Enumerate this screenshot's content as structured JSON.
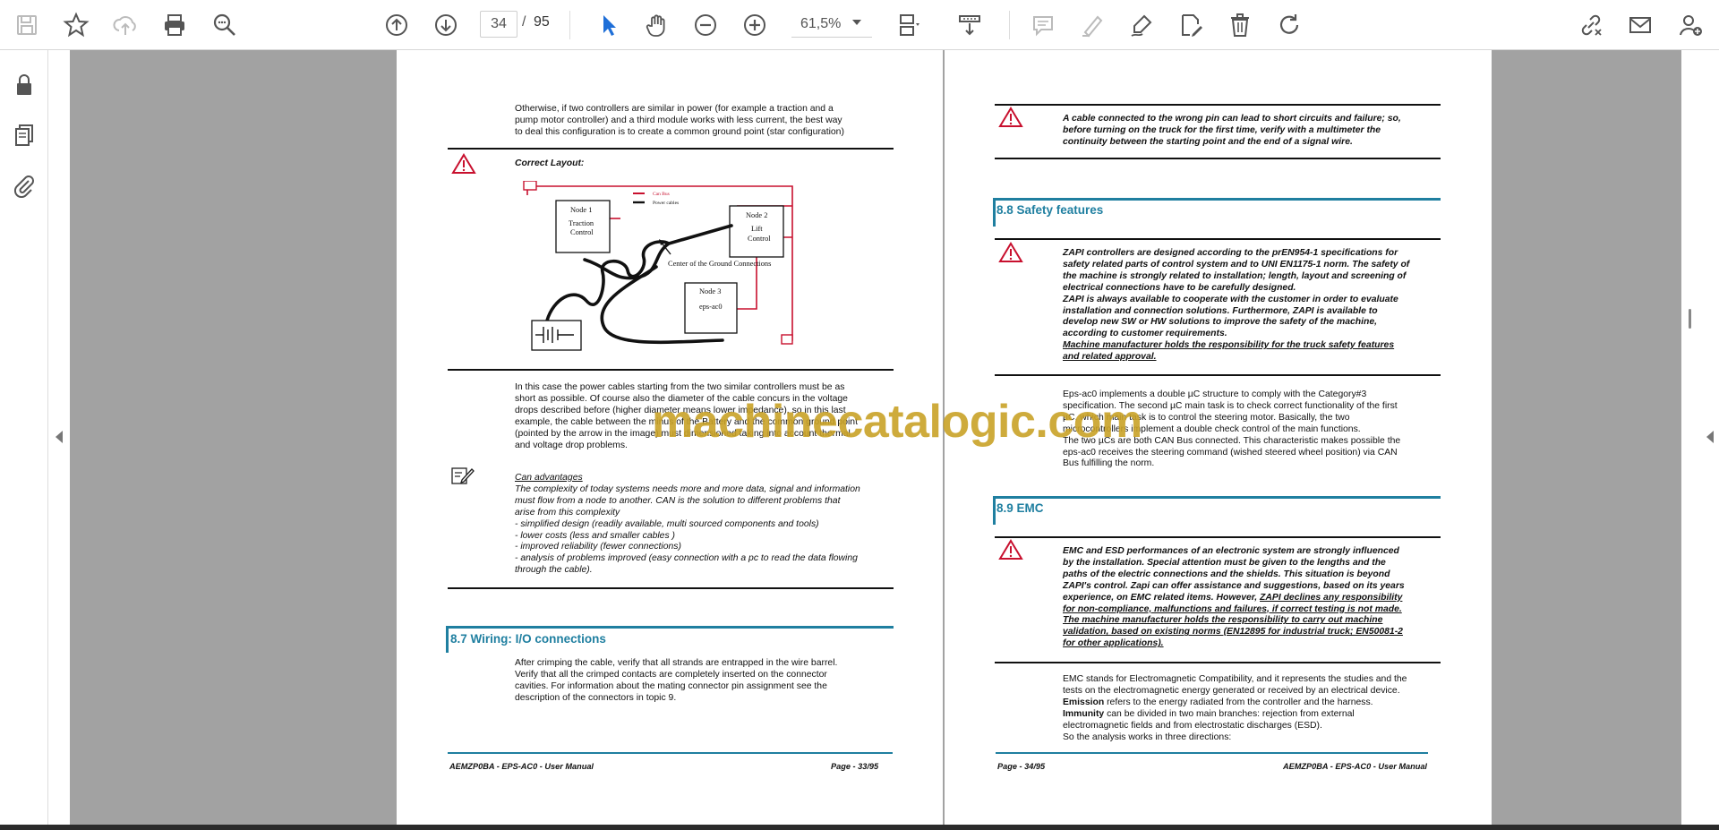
{
  "toolbar": {
    "page_current": "34",
    "page_separator": "/",
    "page_total": "95",
    "zoom": "61,5%"
  },
  "watermark": "machinecatalogic.com",
  "left_page": {
    "para1": [
      "Otherwise, if two controllers are similar in power (for example a traction and a",
      "pump motor controller) and a third module works with less current, the best way",
      "to deal this configuration is to create a common ground point (star configuration)"
    ],
    "correct_layout": "Correct Layout:",
    "diagram": {
      "node1": [
        "Node 1",
        "Traction",
        "Control"
      ],
      "node2": [
        "Node 2",
        "Lift",
        "Control"
      ],
      "node3": [
        "Node 3",
        "eps-ac0"
      ],
      "legend_can": "Can Bus",
      "legend_power": "Power cables",
      "ground_label": "Center of the Ground Connections"
    },
    "para2": [
      "In this case the power cables starting from the two similar controllers must be as",
      "short as possible. Of course also the diameter of the cable concurs in the voltage",
      "drops described before (higher diameter means lower impedance), so in this last",
      "example, the cable between the minus of the Battery and the common ground point",
      "(pointed by the arrow in the image) must dimensioned taking into account thermal",
      "and voltage drop problems."
    ],
    "can_title": "Can advantages",
    "can_lines": [
      "The complexity of today systems needs more and more data, signal and information",
      "must flow from a node to another. CAN is the solution to different problems that",
      "arise from this complexity",
      "- simplified design (readily available, multi sourced components and tools)",
      "- lower costs (less and smaller cables )",
      "- improved reliability (fewer connections)",
      "- analysis of problems improved (easy connection with a pc to read the data flowing",
      "through the cable)."
    ],
    "section_87": "8.7  Wiring: I/O connections",
    "para3": [
      "After crimping the cable, verify that all strands are entrapped in the wire barrel.",
      "Verify that all the crimped contacts are completely inserted on the connector",
      "cavities. For information about the mating connector pin assignment see the",
      "description of the connectors in topic 9."
    ],
    "footer_left": "AEMZP0BA - EPS-AC0 - User Manual",
    "footer_right": "Page - 33/95"
  },
  "right_page": {
    "warn1": [
      "A cable connected to the wrong pin can lead to short circuits and failure; so,",
      "before turning on the truck for the first time, verify with a multimeter the",
      "continuity between the starting point and the end of a signal wire."
    ],
    "section_88": "8.8  Safety features",
    "safety_lines": [
      "ZAPI controllers are designed according to the prEN954-1 specifications for",
      "safety related parts of control system and to UNI EN1175-1 norm. The safety of",
      "the machine is strongly related to installation; length, layout and screening of",
      "electrical connections have to be carefully designed.",
      "ZAPI is always available to cooperate with the customer in order to evaluate",
      "installation and connection solutions. Furthermore, ZAPI is available to",
      "develop new SW or HW solutions to improve the safety of the machine,",
      "according to customer requirements."
    ],
    "safety_underlined": [
      "Machine manufacturer holds the responsibility for the truck safety features",
      "and related approval."
    ],
    "eps_lines": [
      "Eps-ac0 implements a double µC structure to comply with the Category#3",
      "specification. The second µC main task is to check correct functionality of the first",
      "µC, which main task is to control the steering motor. Basically, the two",
      "microcontrollers implement a double check control of the main functions.",
      "The two µCs are both CAN Bus connected. This characteristic makes possible the",
      "eps-ac0 receives the steering command (wished steered wheel position) via CAN",
      "Bus fulfilling the norm."
    ],
    "section_89": "8.9  EMC",
    "emc_warn_lines": [
      "EMC and ESD performances of an electronic system are strongly influenced",
      "by the installation. Special attention must be given to the lengths and the",
      "paths of the electric connections and the shields. This situation is beyond",
      "ZAPI's control. Zapi can offer assistance and suggestions, based on its years"
    ],
    "emc_warn_mixed_plain": "experience, on EMC related items. However, ",
    "emc_warn_mixed_under": "ZAPI declines any responsibility",
    "emc_warn_underlined": [
      "for non-compliance, malfunctions and failures, if correct testing is not made.",
      "The machine manufacturer holds the responsibility to carry out machine",
      "validation, based on existing norms (EN12895 for industrial truck; EN50081-2",
      "for other applications)."
    ],
    "emc_body_lines": [
      "EMC stands for Electromagnetic Compatibility, and it represents the studies and the",
      "tests on the electromagnetic energy generated or received by an electrical device."
    ],
    "emission_bold": "Emission",
    "emission_rest": " refers to the energy radiated from the controller and the harness.",
    "immunity_bold": "Immunity",
    "immunity_rest": " can be divided in two main branches: rejection from external",
    "emc_tail_lines": [
      "electromagnetic fields and from electrostatic discharges (ESD).",
      "So the analysis works in three directions:"
    ],
    "footer_left": "Page - 34/95",
    "footer_right": "AEMZP0BA - EPS-AC0 - User Manual"
  }
}
